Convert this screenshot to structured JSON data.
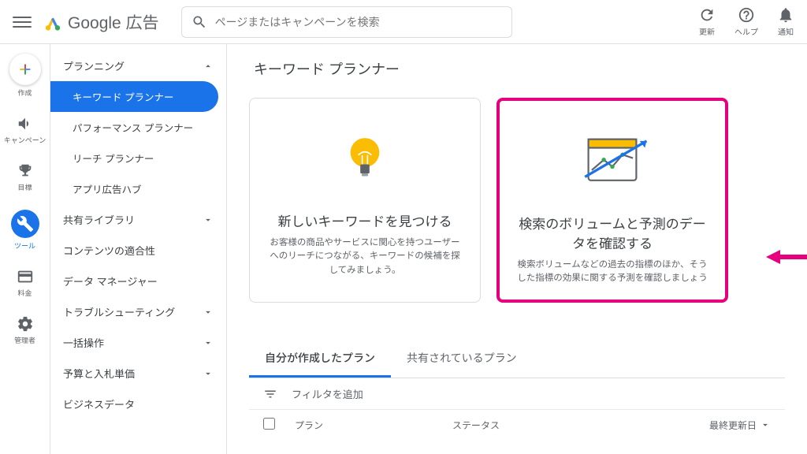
{
  "header": {
    "product_name": "Google 広告",
    "search_placeholder": "ページまたはキャンペーンを検索",
    "right_icons": {
      "refresh": "更新",
      "help": "ヘルプ",
      "notifications": "通知"
    }
  },
  "rail": {
    "create": "作成",
    "campaign": "キャンペーン",
    "goals": "目標",
    "tools": "ツール",
    "billing": "料金",
    "admin": "管理者"
  },
  "sidebar": {
    "groups": [
      {
        "label": "プランニング",
        "expanded": true,
        "items": [
          {
            "label": "キーワード プランナー",
            "active": true
          },
          {
            "label": "パフォーマンス プランナー"
          },
          {
            "label": "リーチ プランナー"
          },
          {
            "label": "アプリ広告ハブ"
          }
        ]
      },
      {
        "label": "共有ライブラリ",
        "expanded": false
      },
      {
        "label": "コンテンツの適合性",
        "expanded": false,
        "no_chev": true
      },
      {
        "label": "データ マネージャー",
        "expanded": false,
        "no_chev": true
      },
      {
        "label": "トラブルシューティング",
        "expanded": false
      },
      {
        "label": "一括操作",
        "expanded": false
      },
      {
        "label": "予算と入札単価",
        "expanded": false
      },
      {
        "label": "ビジネスデータ",
        "expanded": false,
        "no_chev": true
      }
    ]
  },
  "main": {
    "title": "キーワード プランナー",
    "card_discover": {
      "title": "新しいキーワードを見つける",
      "desc": "お客様の商品やサービスに関心を持つユーザーへのリーチにつながる、キーワードの候補を探してみましょう。"
    },
    "card_forecast": {
      "title": "検索のボリュームと予測のデータを確認する",
      "desc": "検索ボリュームなどの過去の指標のほか、そうした指標の効果に関する予測を確認しましょう"
    },
    "plans": {
      "tab_mine": "自分が作成したプラン",
      "tab_shared": "共有されているプラン",
      "filter_label": "フィルタを追加",
      "col_plan": "プラン",
      "col_status": "ステータス",
      "col_updated": "最終更新日"
    }
  }
}
